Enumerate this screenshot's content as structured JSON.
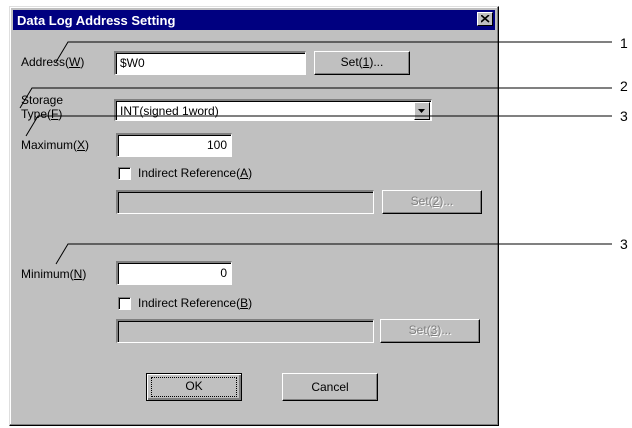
{
  "dialog": {
    "title": "Data Log Address Setting"
  },
  "address": {
    "label": "Address",
    "mnemonic": "W",
    "value": "$W0",
    "set_button": {
      "label": "Set",
      "mnemonic": "1",
      "suffix": "..."
    }
  },
  "storage_type": {
    "label_line1": "Storage",
    "label_line2": "Type",
    "mnemonic": "F",
    "selected": "INT(signed 1word)"
  },
  "maximum": {
    "label": "Maximum",
    "mnemonic": "X",
    "value": "100",
    "indirect": {
      "label": "Indirect Reference",
      "mnemonic": "A",
      "checked": false
    },
    "indirect_value": "",
    "set_button": {
      "label": "Set",
      "mnemonic": "2",
      "suffix": "..."
    }
  },
  "minimum": {
    "label": "Minimum",
    "mnemonic": "N",
    "value": "0",
    "indirect": {
      "label": "Indirect Reference",
      "mnemonic": "B",
      "checked": false
    },
    "indirect_value": "",
    "set_button": {
      "label": "Set",
      "mnemonic": "3",
      "suffix": "..."
    }
  },
  "buttons": {
    "ok": "OK",
    "cancel": "Cancel"
  },
  "callouts": [
    "1",
    "2",
    "3",
    "3"
  ],
  "colors": {
    "title_bar": "#000080",
    "face": "#c0c0c0"
  }
}
